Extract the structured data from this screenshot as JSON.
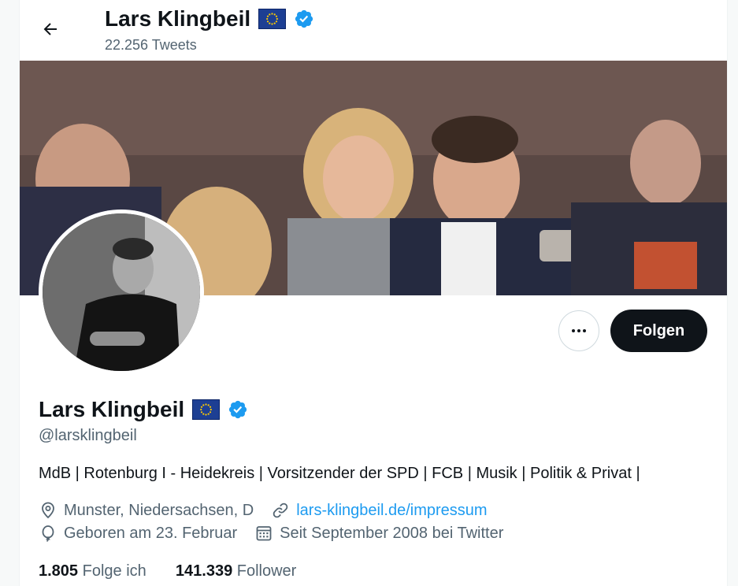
{
  "header": {
    "name": "Lars Klingbeil",
    "tweet_count": "22.256 Tweets"
  },
  "profile": {
    "name": "Lars Klingbeil",
    "handle": "@larsklingbeil",
    "bio": "MdB | Rotenburg I - Heidekreis | Vorsitzender der SPD | FCB | Musik | Politik & Privat |",
    "location": "Munster, Niedersachsen, D",
    "website": "lars-klingbeil.de/impressum",
    "birthday": "Geboren am 23. Februar",
    "joined": "Seit September 2008 bei Twitter",
    "following_count": "1.805",
    "following_label": "Folge ich",
    "followers_count": "141.339",
    "followers_label": "Follower"
  },
  "actions": {
    "follow_label": "Folgen"
  },
  "colors": {
    "accent": "#1d9bf0",
    "text": "#0f1419",
    "secondary": "#536471",
    "follow_bg": "#0f1419",
    "eu_blue": "#1d3f93",
    "eu_gold": "#ffcc00"
  },
  "icons": {
    "back": "arrow-left-icon",
    "verified": "verified-badge-icon",
    "flag": "eu-flag-icon",
    "more": "more-horizontal-icon",
    "location": "location-pin-icon",
    "link": "link-icon",
    "birthday": "balloon-icon",
    "calendar": "calendar-icon"
  }
}
